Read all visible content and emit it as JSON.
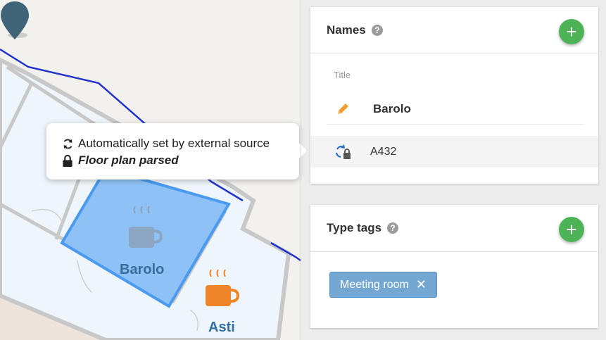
{
  "map": {
    "rooms": [
      {
        "label": "Barolo",
        "icon": "coffee-cup-icon",
        "selected": true
      },
      {
        "label": "Asti",
        "icon": "coffee-cup-icon",
        "selected": false
      }
    ],
    "marker_icon": "map-pin-icon"
  },
  "tooltip": {
    "line1": {
      "icon": "sync-icon",
      "text": "Automatically set by external source"
    },
    "line2": {
      "icon": "lock-icon",
      "text": "Floor plan parsed"
    }
  },
  "names_card": {
    "title": "Names",
    "help_icon": "?",
    "add_icon": "+",
    "field_label": "Title",
    "entries": [
      {
        "icon": "pencil-icon",
        "value": "Barolo"
      },
      {
        "icon": "sync-lock-icon",
        "value": "A432"
      }
    ]
  },
  "type_tags_card": {
    "title": "Type tags",
    "help_icon": "?",
    "add_icon": "+",
    "tags": [
      {
        "label": "Meeting room",
        "remove_icon": "✕"
      }
    ]
  },
  "colors": {
    "accent_green": "#4cb356",
    "tag_blue": "#74a8d3",
    "selected_room": "#7db9f5",
    "wall_blue": "#2233cc",
    "coffee_orange": "#f0862a"
  }
}
